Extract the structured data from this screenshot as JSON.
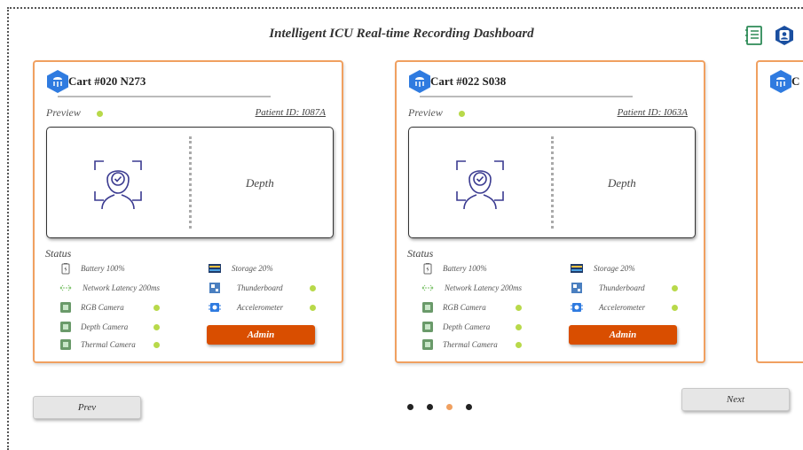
{
  "header": {
    "title": "Intelligent ICU Real-time Recording Dashboard"
  },
  "icons": {
    "notebook": "notebook-icon",
    "user": "user-badge-icon",
    "cart": "cart-hex-icon"
  },
  "colors": {
    "accent": "#d94e00",
    "card_border": "#f0a060",
    "ok_dot": "#b8d94a",
    "hex_blue": "#2f7be0",
    "pager_active": "#f0a060",
    "pager_inactive": "#222222"
  },
  "cards": [
    {
      "name": "Cart #020 N273",
      "preview_label": "Preview",
      "patient_id": "Patient ID: I087A",
      "depth_label": "Depth",
      "status_label": "Status",
      "battery": "Battery 100%",
      "latency": "Network Latency 200ms",
      "rgb": "RGB Camera",
      "depth_cam": "Depth Camera",
      "thermal": "Thermal Camera",
      "storage": "Storage 20%",
      "thunderboard": "Thunderboard",
      "accelerometer": "Accelerometer",
      "admin_label": "Admin"
    },
    {
      "name": "Cart #022 S038",
      "preview_label": "Preview",
      "patient_id": "Patient ID: I063A",
      "depth_label": "Depth",
      "status_label": "Status",
      "battery": "Battery 100%",
      "latency": "Network Latency 200ms",
      "rgb": "RGB Camera",
      "depth_cam": "Depth Camera",
      "thermal": "Thermal Camera",
      "storage": "Storage 20%",
      "thunderboard": "Thunderboard",
      "accelerometer": "Accelerometer",
      "admin_label": "Admin"
    },
    {
      "name": "C"
    }
  ],
  "pagination": {
    "prev_label": "Prev",
    "next_label": "Next",
    "total_pages": 4,
    "current_page": 3
  }
}
